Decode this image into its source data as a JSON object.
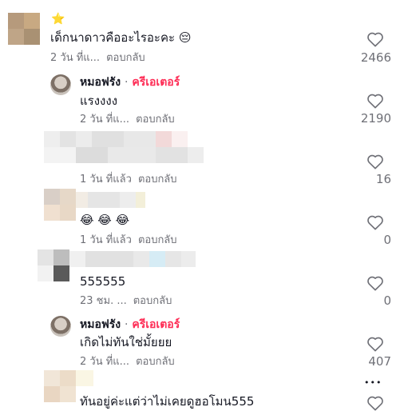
{
  "comments": [
    {
      "text": "เด็กนาดาวคืออะไรอะคะ 😔",
      "badge": "⭐",
      "time": "2 วัน ที่แ...",
      "reply_label": "ตอบกลับ",
      "likes": "2466"
    },
    {
      "author": "หมอฟรัง",
      "separator": "·",
      "role": "ครีเอเตอร์",
      "text": "แรงงงง",
      "time": "2 วัน ที่แ...",
      "reply_label": "ตอบกลับ",
      "likes": "2190"
    },
    {
      "time": "1 วัน ที่แล้ว",
      "reply_label": "ตอบกลับ",
      "likes": "16"
    },
    {
      "text": "😂 😂 😂",
      "time": "1 วัน ที่แล้ว",
      "reply_label": "ตอบกลับ",
      "likes": "0"
    },
    {
      "text": "555555",
      "time": "23 ชม. ...",
      "reply_label": "ตอบกลับ",
      "likes": "0"
    },
    {
      "author": "หมอฟรัง",
      "separator": "·",
      "role": "ครีเอเตอร์",
      "text": "เกิดไม่ทันใช่มั้ยยย",
      "time": "2 วัน ที่แ...",
      "reply_label": "ตอบกลับ",
      "likes": "407"
    },
    {
      "text": "ทันอยู่ค่ะแต่ว่าไม่เคยดูฮอโมน555",
      "more": "•••"
    }
  ],
  "colors": {
    "creator": "#fe2c55",
    "muted": "#6f7077"
  },
  "icons": {
    "like": "heart-outline-icon",
    "more": "more-dots-icon"
  }
}
